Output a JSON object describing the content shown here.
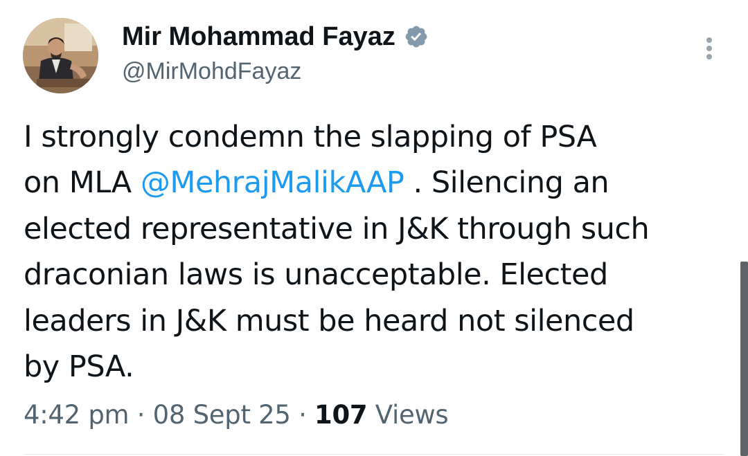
{
  "author": {
    "name": "Mir Mohammad Fayaz",
    "handle": "@MirMohdFayaz",
    "verified": true
  },
  "icons": {
    "verified": "verified-badge-icon",
    "more": "more-vertical-icon",
    "avatar": "profile-photo"
  },
  "tweet": {
    "lines": [
      {
        "text": "I strongly condemn the slapping of PSA"
      },
      {
        "before": "on MLA ",
        "mention": "@MehrajMalikAAP",
        "after": " . Silencing an"
      },
      {
        "text": "elected representative in J&K through such"
      },
      {
        "text": "draconian laws is unacceptable. Elected"
      },
      {
        "text": "leaders in J&K must be heard not silenced"
      },
      {
        "text": "by PSA."
      }
    ]
  },
  "meta": {
    "time": "4:42 pm",
    "separator": " · ",
    "date": "08 Sept 25",
    "views_count": "107",
    "views_label": " Views"
  },
  "colors": {
    "text": "#0f1419",
    "secondary": "#536471",
    "link": "#1d9bf0",
    "badge": "#829aab"
  }
}
